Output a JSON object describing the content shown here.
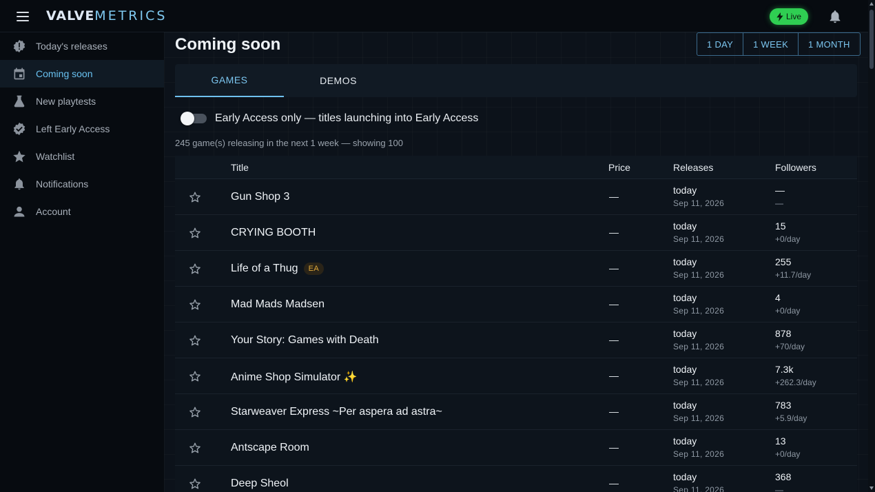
{
  "app": {
    "logo_bold": "VALVE",
    "logo_light": "METRICS",
    "live_label": "Live",
    "colors": {
      "accent": "#6fc1ef",
      "live": "#2fce52",
      "ea_badge": "#e0a93a"
    }
  },
  "sidebar": {
    "items": [
      {
        "label": "Today's releases",
        "icon": "gear-badge-icon",
        "active": false
      },
      {
        "label": "Coming soon",
        "icon": "calendar-icon",
        "active": true
      },
      {
        "label": "New playtests",
        "icon": "flask-icon",
        "active": false
      },
      {
        "label": "Left Early Access",
        "icon": "verified-badge-icon",
        "active": false
      },
      {
        "label": "Watchlist",
        "icon": "star-icon",
        "active": false
      },
      {
        "label": "Notifications",
        "icon": "bell-icon",
        "active": false
      },
      {
        "label": "Account",
        "icon": "person-icon",
        "active": false
      }
    ]
  },
  "main": {
    "title": "Coming soon",
    "ranges": [
      "1 DAY",
      "1 WEEK",
      "1 MONTH"
    ],
    "tabs": [
      {
        "label": "GAMES",
        "active": true
      },
      {
        "label": "DEMOS",
        "active": false
      }
    ],
    "toggle_label": "Early Access only — titles launching into Early Access",
    "summary": "245 game(s) releasing in the next 1 week — showing 100"
  },
  "table": {
    "headers": {
      "title": "Title",
      "price": "Price",
      "releases": "Releases",
      "followers": "Followers"
    },
    "rows": [
      {
        "title": "Gun Shop 3",
        "badge": "",
        "price": "—",
        "release": "today",
        "date": "Sep 11, 2026",
        "followers": "—",
        "rate": "—"
      },
      {
        "title": "CRYING BOOTH",
        "badge": "",
        "price": "—",
        "release": "today",
        "date": "Sep 11, 2026",
        "followers": "15",
        "rate": "+0/day"
      },
      {
        "title": "Life of a Thug",
        "badge": "EA",
        "price": "—",
        "release": "today",
        "date": "Sep 11, 2026",
        "followers": "255",
        "rate": "+11.7/day"
      },
      {
        "title": "Mad Mads Madsen",
        "badge": "",
        "price": "—",
        "release": "today",
        "date": "Sep 11, 2026",
        "followers": "4",
        "rate": "+0/day"
      },
      {
        "title": "Your Story: Games with Death",
        "badge": "",
        "price": "—",
        "release": "today",
        "date": "Sep 11, 2026",
        "followers": "878",
        "rate": "+70/day"
      },
      {
        "title": "Anime Shop Simulator ✨",
        "badge": "",
        "price": "—",
        "release": "today",
        "date": "Sep 11, 2026",
        "followers": "7.3k",
        "rate": "+262.3/day"
      },
      {
        "title": "Starweaver Express ~Per aspera ad astra~",
        "badge": "",
        "price": "—",
        "release": "today",
        "date": "Sep 11, 2026",
        "followers": "783",
        "rate": "+5.9/day"
      },
      {
        "title": "Antscape Room",
        "badge": "",
        "price": "—",
        "release": "today",
        "date": "Sep 11, 2026",
        "followers": "13",
        "rate": "+0/day"
      },
      {
        "title": "Deep Sheol",
        "badge": "",
        "price": "—",
        "release": "today",
        "date": "Sep 11, 2026",
        "followers": "368",
        "rate": "—"
      }
    ]
  }
}
